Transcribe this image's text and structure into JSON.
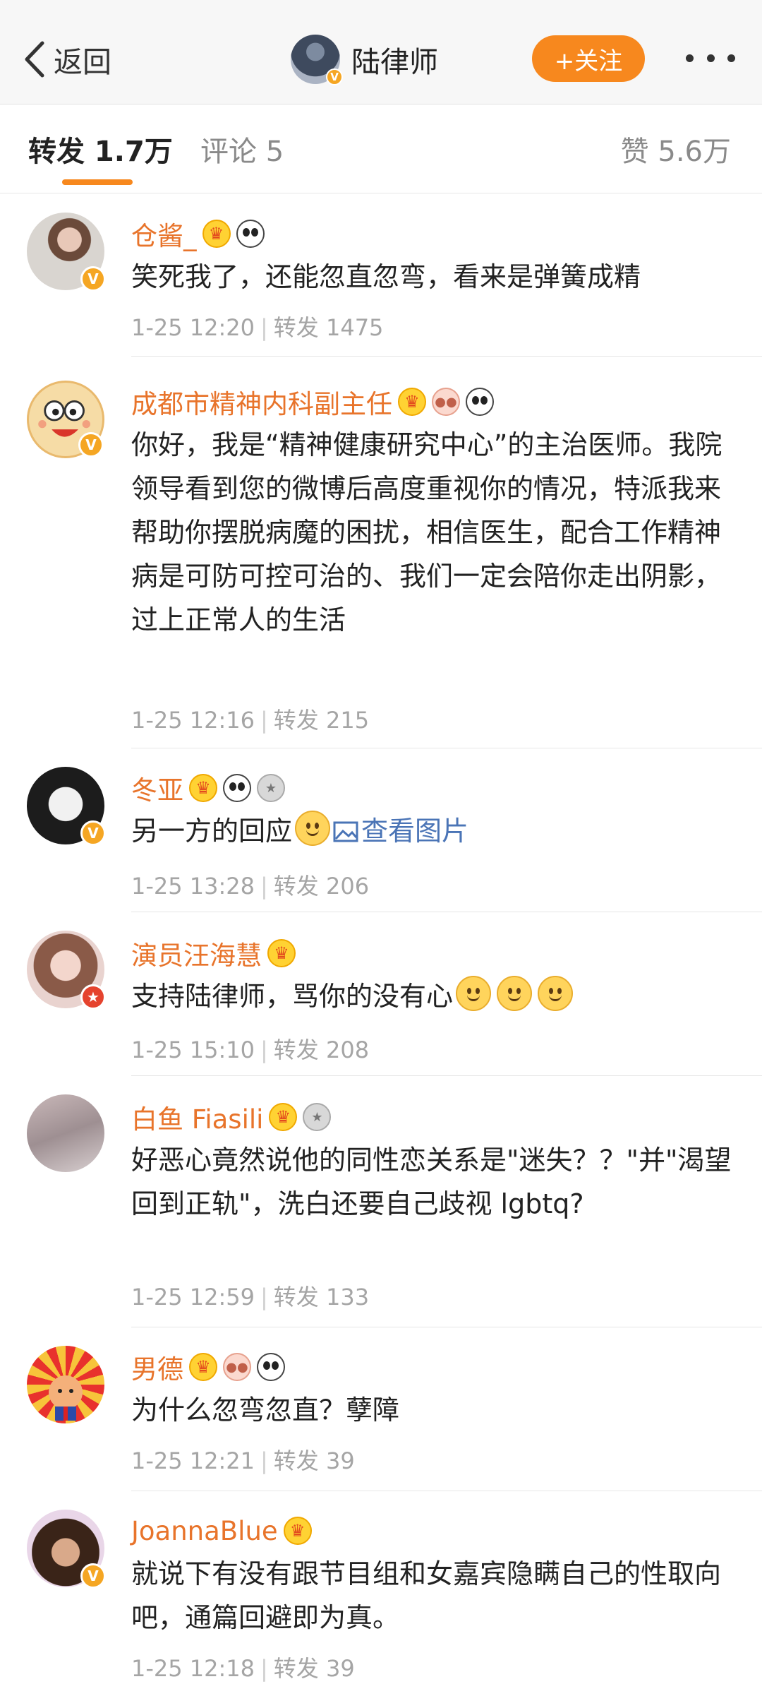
{
  "header": {
    "back_label": "返回",
    "title": "陆律师",
    "follow_label": "+关注"
  },
  "tabs": {
    "repost": "转发 1.7万",
    "comment": "评论 5",
    "likes": "赞 5.6万"
  },
  "reposts": [
    {
      "name": "仓酱_",
      "badges": [
        "crown-icon",
        "panda-icon"
      ],
      "text": "笑死我了，还能忽直忽弯，看来是弹簧成精",
      "time": "1-25 12:20",
      "repost_count": "转发 1475"
    },
    {
      "name": "成都市精神内科副主任",
      "badges": [
        "crown-icon",
        "pig-icon",
        "panda-icon"
      ],
      "text": "你好，我是“精神健康研究中心”的主治医师。我院领导看到您的微博后高度重视你的情况，特派我来帮助你摆脱病魔的困扰，相信医生，配合工作精神病是可防可控可治的、我们一定会陪你走出阴影，过上正常人的生活",
      "time": "1-25 12:16",
      "repost_count": "转发 215"
    },
    {
      "name": "冬亚",
      "badges": [
        "crown-icon",
        "panda-icon",
        "medal-icon"
      ],
      "text": "另一方的回应",
      "link": "查看图片",
      "time": "1-25 13:28",
      "repost_count": "转发 206"
    },
    {
      "name": "演员汪海慧",
      "badges": [
        "crown-icon"
      ],
      "text": "支持陆律师，骂你的没有心",
      "time": "1-25 15:10",
      "repost_count": "转发 208"
    },
    {
      "name": "白鱼 Fiasili",
      "badges": [
        "crown-icon",
        "medal-icon"
      ],
      "text": "好恶心竟然说他的同性恋关系是\"迷失？？\"并\"渴望回到正轨\"，洗白还要自己歧视 lgbtq?",
      "time": "1-25 12:59",
      "repost_count": "转发 133"
    },
    {
      "name": "男德",
      "badges": [
        "crown-icon",
        "pig-icon",
        "panda-icon"
      ],
      "text": "为什么忽弯忽直？孽障",
      "time": "1-25 12:21",
      "repost_count": "转发 39"
    },
    {
      "name": "JoannaBlue",
      "badges": [
        "crown-icon"
      ],
      "text": "就说下有没有跟节目组和女嘉宾隐瞒自己的性取向吧，通篇回避即为真。",
      "time": "1-25 12:18",
      "repost_count": "转发 39"
    }
  ],
  "colors": {
    "accent": "#f7881e",
    "username": "#e8742b",
    "link": "#4a74b6",
    "meta": "#a5a5a5"
  }
}
